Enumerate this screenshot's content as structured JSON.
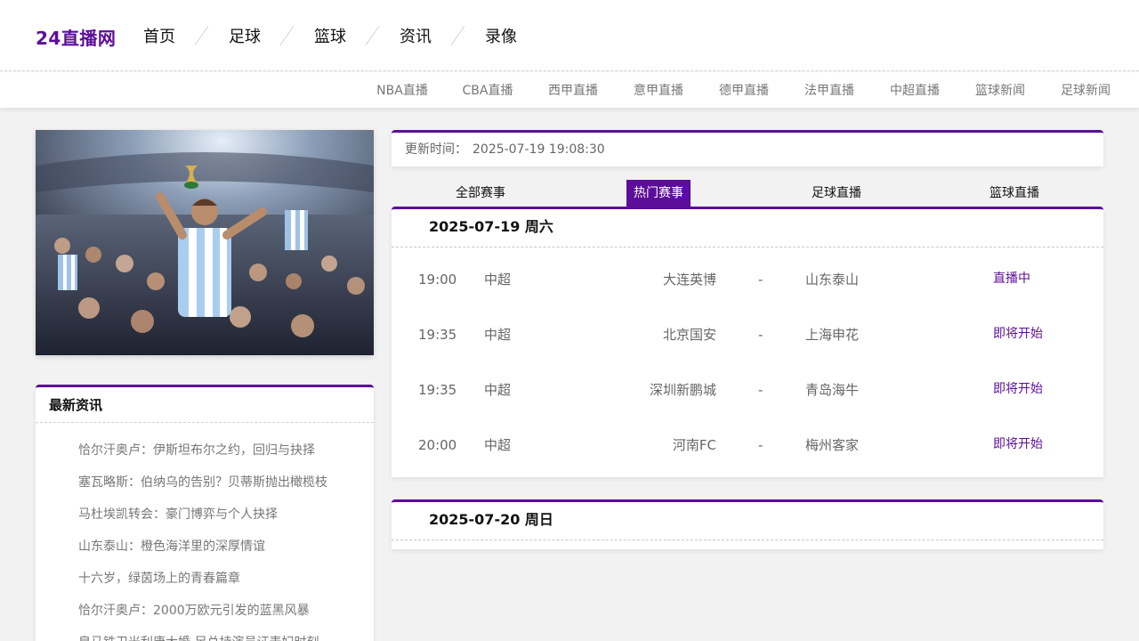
{
  "site": {
    "logo": "24直播网"
  },
  "main_nav": [
    {
      "label": "首页"
    },
    {
      "label": "足球"
    },
    {
      "label": "篮球"
    },
    {
      "label": "资讯"
    },
    {
      "label": "录像"
    }
  ],
  "sub_nav": [
    {
      "label": "NBA直播"
    },
    {
      "label": "CBA直播"
    },
    {
      "label": "西甲直播"
    },
    {
      "label": "意甲直播"
    },
    {
      "label": "德甲直播"
    },
    {
      "label": "法甲直播"
    },
    {
      "label": "中超直播"
    },
    {
      "label": "篮球新闻"
    },
    {
      "label": "足球新闻"
    }
  ],
  "news": {
    "title": "最新资讯",
    "items": [
      "恰尔汗奥卢：伊斯坦布尔之约，回归与抉择",
      "塞瓦略斯：伯纳乌的告别？贝蒂斯抛出橄榄枝",
      "马杜埃凯转会：豪门博弈与个人抉择",
      "山东泰山：橙色海洋里的深厚情谊",
      "十六岁，绿茵场上的青春篇章",
      "恰尔汗奥卢：2000万欧元引发的蓝黑风暴",
      "皇马铁卫米利唐大婚 足总持演员证表妇时刻"
    ]
  },
  "update": {
    "label": "更新时间：",
    "time": "2025-07-19 19:08:30"
  },
  "tabs": [
    {
      "label": "全部赛事",
      "active": false
    },
    {
      "label": "热门赛事",
      "active": true
    },
    {
      "label": "足球直播",
      "active": false
    },
    {
      "label": "篮球直播",
      "active": false
    }
  ],
  "days": [
    {
      "date": "2025-07-19 周六",
      "matches": [
        {
          "time": "19:00",
          "league": "中超",
          "home": "大连英博",
          "vs": "-",
          "away": "山东泰山",
          "status": "直播中"
        },
        {
          "time": "19:35",
          "league": "中超",
          "home": "北京国安",
          "vs": "-",
          "away": "上海申花",
          "status": "即将开始"
        },
        {
          "time": "19:35",
          "league": "中超",
          "home": "深圳新鹏城",
          "vs": "-",
          "away": "青岛海牛",
          "status": "即将开始"
        },
        {
          "time": "20:00",
          "league": "中超",
          "home": "河南FC",
          "vs": "-",
          "away": "梅州客家",
          "status": "即将开始"
        }
      ]
    },
    {
      "date": "2025-07-20 周日",
      "matches": []
    }
  ],
  "colors": {
    "accent": "#5c0d99",
    "background": "#f2f2f2"
  }
}
